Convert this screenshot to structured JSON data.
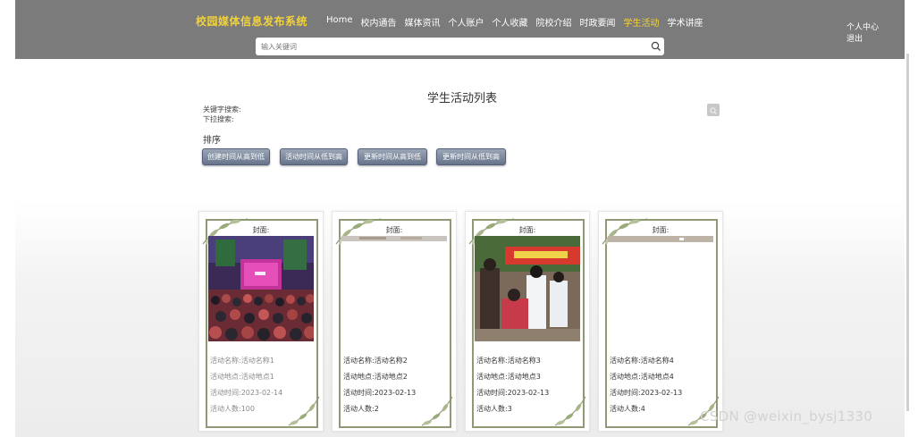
{
  "header": {
    "brand": "校园媒体信息发布系统",
    "nav": [
      "Home",
      "校内通告",
      "媒体资讯",
      "个人账户",
      "个人收藏",
      "院校介绍",
      "时政要闻",
      "学生活动",
      "学术讲座"
    ],
    "active_nav": "学生活动",
    "user_center": "个人中心",
    "logout": "退出",
    "search_placeholder": "输入关键词"
  },
  "list": {
    "title": "学生活动列表",
    "keyword_label": "关键字搜索:",
    "dropdown_label": "下拉搜索:",
    "sort_label": "排序",
    "sort_buttons": [
      "创建时间从高到低",
      "活动时间从低到高",
      "更新时间从高到低",
      "更新时间从低到高"
    ]
  },
  "cards": [
    {
      "cover_label": "封面:",
      "name": "活动名称:活动名称1",
      "location": "活动地点:活动地点1",
      "time": "活动时间:2023-02-14",
      "people": "活动人数:100"
    },
    {
      "cover_label": "封面:",
      "name": "活动名称:活动名称2",
      "location": "活动地点:活动地点2",
      "time": "活动时间:2023-02-13",
      "people": "活动人数:2"
    },
    {
      "cover_label": "封面:",
      "name": "活动名称:活动名称3",
      "location": "活动地点:活动地点3",
      "time": "活动时间:2023-02-13",
      "people": "活动人数:3"
    },
    {
      "cover_label": "封面:",
      "name": "活动名称:活动名称4",
      "location": "活动地点:活动地点4",
      "time": "活动时间:2023-02-13",
      "people": "活动人数:4"
    }
  ],
  "watermark": "CSDN @weixin_bysj1330",
  "colors": {
    "topbar": "#7b7b7b",
    "brand": "#f2d23a",
    "active_nav": "#f2d23a",
    "card_frame": "#8f9a74",
    "sort_button": "#67738a"
  }
}
